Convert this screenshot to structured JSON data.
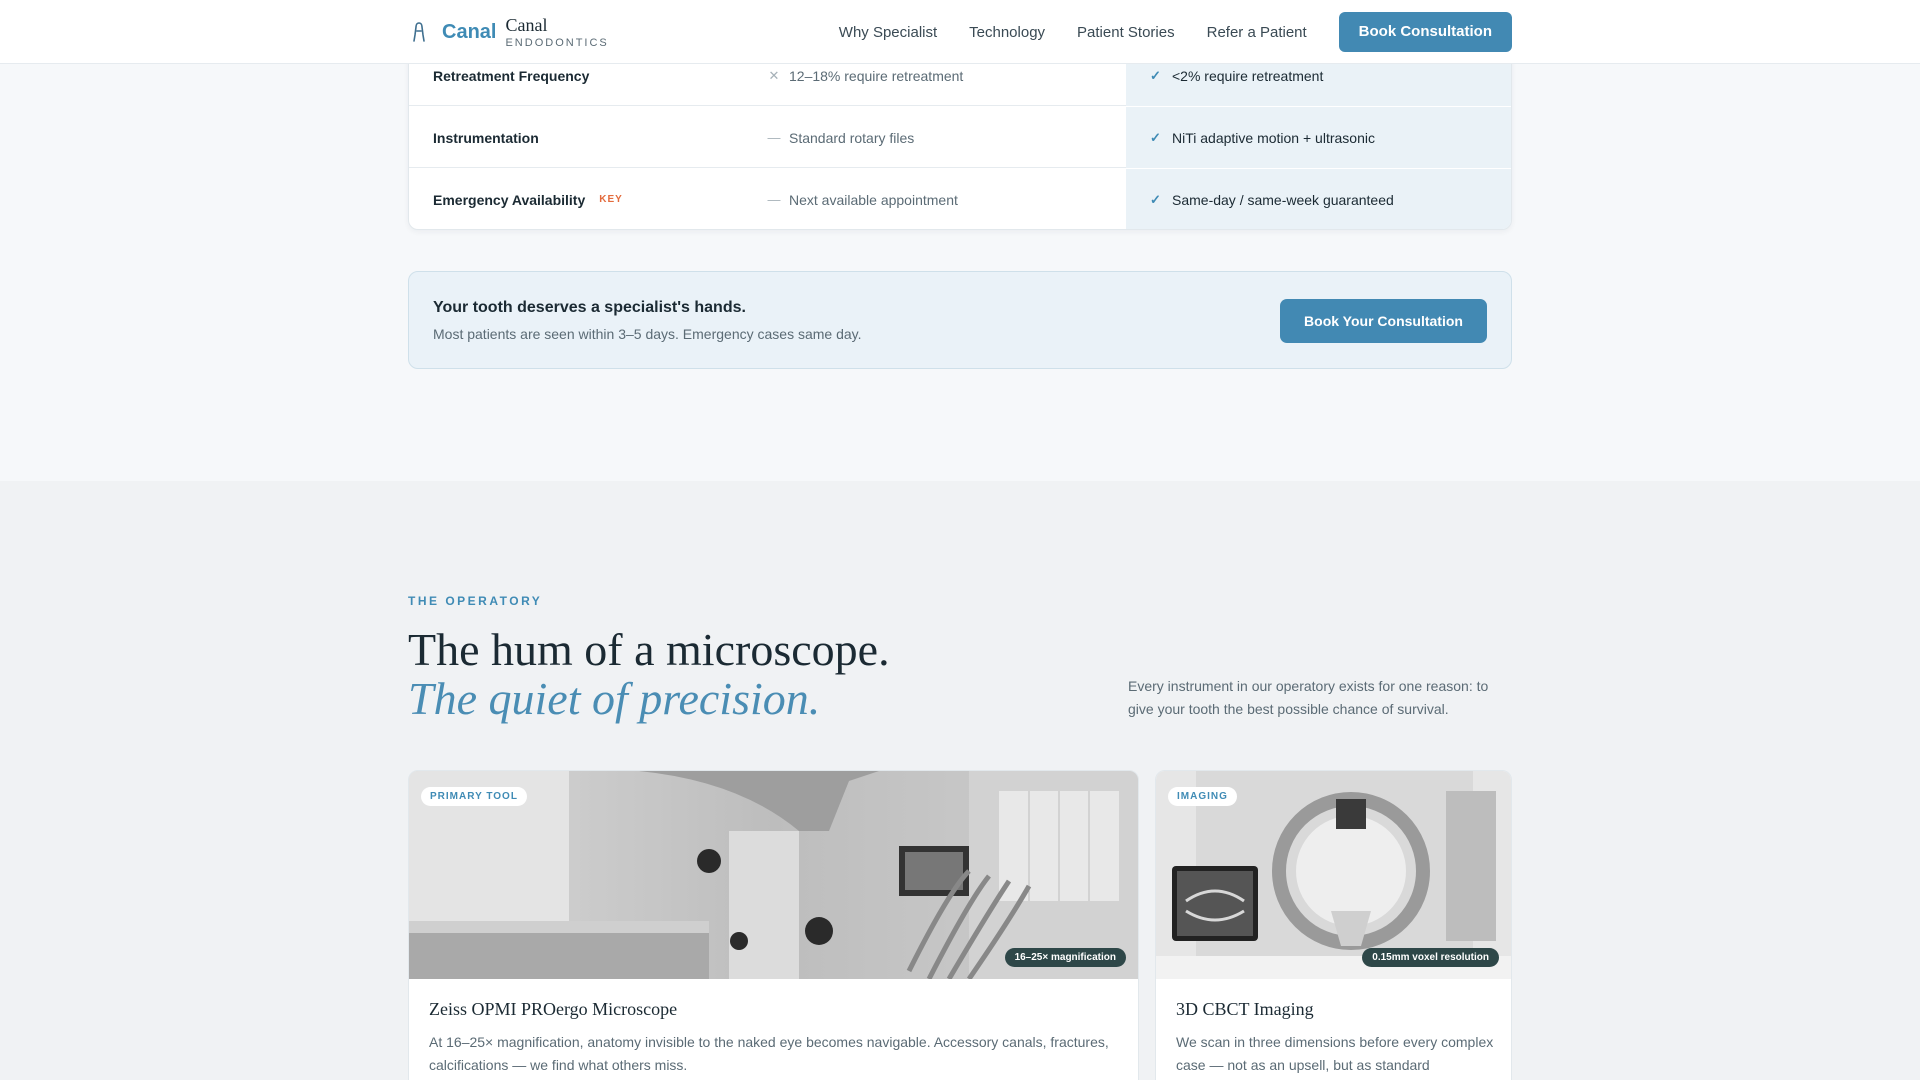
{
  "brand": {
    "word": "Canal",
    "serif": "Canal",
    "sub": "ENDODONTICS",
    "accent": "#3f8bb5"
  },
  "nav": {
    "links": [
      "Why Specialist",
      "Technology",
      "Patient Stories",
      "Refer a Patient"
    ],
    "cta": "Book Consultation"
  },
  "comparison": {
    "rows": [
      {
        "label": "Retreatment Frequency",
        "badge": "",
        "general_icon": "x-icon",
        "general": "12–18% require retreatment",
        "specialist": "<2% require retreatment"
      },
      {
        "label": "Instrumentation",
        "badge": "",
        "general_icon": "dash-icon",
        "general": "Standard rotary files",
        "specialist": "NiTi adaptive motion + ultrasonic"
      },
      {
        "label": "Emergency Availability",
        "badge": "KEY",
        "general_icon": "dash-icon",
        "general": "Next available appointment",
        "specialist": "Same-day / same-week guaranteed"
      }
    ]
  },
  "cta_banner": {
    "title": "Your tooth deserves a specialist's hands.",
    "subtitle": "Most patients are seen within 3–5 days. Emergency cases same day.",
    "button": "Book Your Consultation"
  },
  "operatory": {
    "eyebrow": "THE OPERATORY",
    "heading": "The hum of a microscope.",
    "heading_italic": "The quiet of precision.",
    "intro": "Every instrument in our operatory exists for one reason: to give your tooth the best possible chance of survival.",
    "cards": [
      {
        "tag": "PRIMARY TOOL",
        "stat": "16–25× magnification",
        "title": "Zeiss OPMI PROergo Microscope",
        "text": "At 16–25× magnification, anatomy invisible to the naked eye becomes navigable. Accessory canals, fractures, calcifications — we find what others miss."
      },
      {
        "tag": "IMAGING",
        "stat": "0.15mm voxel resolution",
        "title": "3D CBCT Imaging",
        "text": "We scan in three dimensions before every complex case — not as an upsell, but as standard"
      }
    ]
  }
}
